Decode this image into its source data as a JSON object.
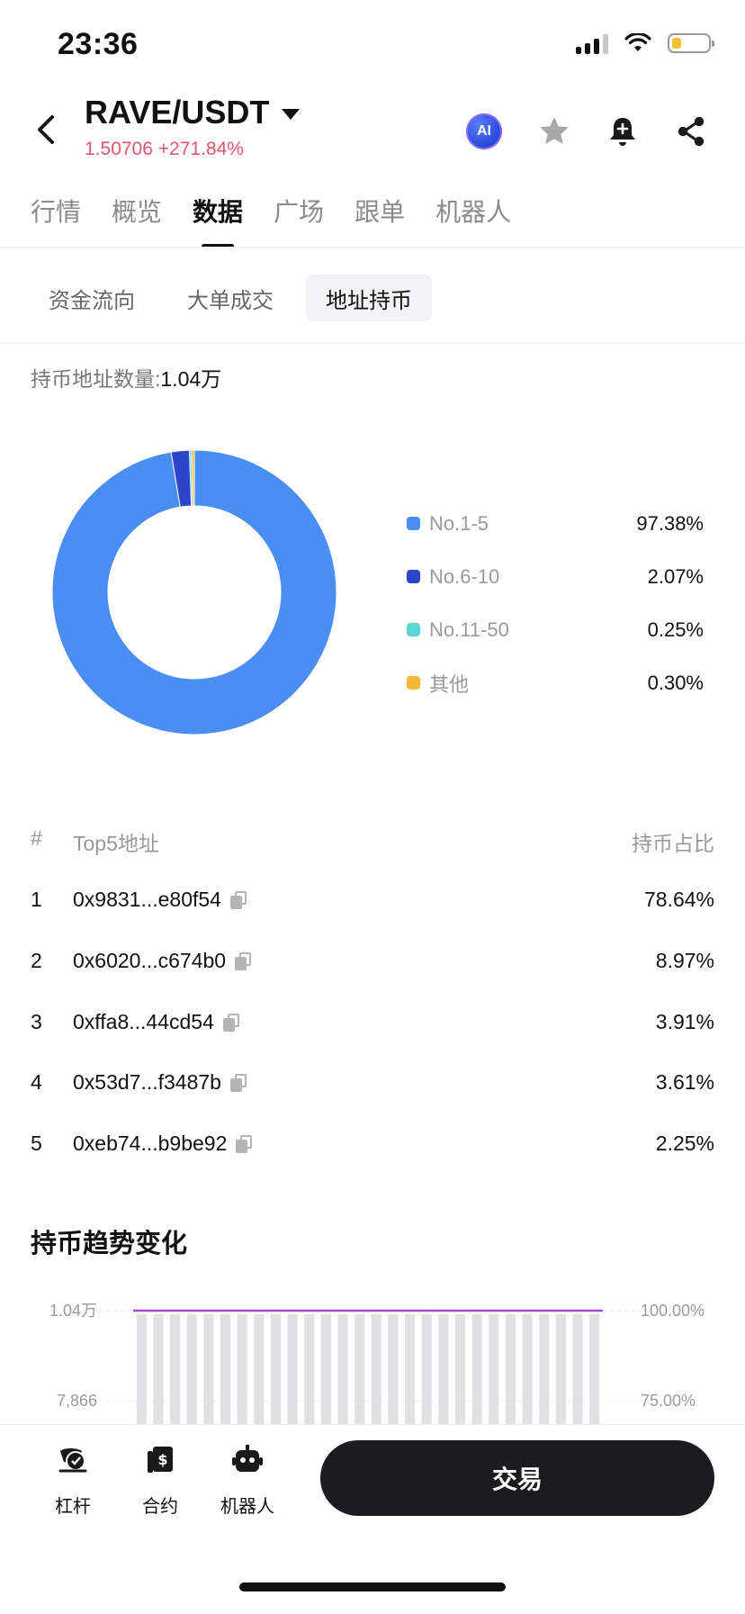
{
  "status": {
    "time": "23:36"
  },
  "header": {
    "pair": "RAVE/USDT",
    "price": "1.50706",
    "change": "+271.84%",
    "ai_label": "AI"
  },
  "tabs": [
    {
      "label": "行情"
    },
    {
      "label": "概览"
    },
    {
      "label": "数据",
      "active": true
    },
    {
      "label": "广场"
    },
    {
      "label": "跟单"
    },
    {
      "label": "机器人"
    }
  ],
  "sub_tabs": [
    {
      "label": "资金流向"
    },
    {
      "label": "大单成交"
    },
    {
      "label": "地址持币",
      "active": true
    }
  ],
  "holders": {
    "label": "持币地址数量:",
    "value": "1.04万"
  },
  "legend": [
    {
      "label": "No.1-5",
      "pct": "97.38%",
      "color": "#4a8ef4"
    },
    {
      "label": "No.6-10",
      "pct": "2.07%",
      "color": "#2d45c8"
    },
    {
      "label": "No.11-50",
      "pct": "0.25%",
      "color": "#5fd6d6"
    },
    {
      "label": "其他",
      "pct": "0.30%",
      "color": "#f0b93a"
    }
  ],
  "chart_data": [
    {
      "type": "pie",
      "categories": [
        "No.1-5",
        "No.6-10",
        "No.11-50",
        "其他"
      ],
      "values": [
        97.38,
        2.07,
        0.25,
        0.3
      ],
      "colors": [
        "#4a8ef4",
        "#2d45c8",
        "#5fd6d6",
        "#f0b93a"
      ],
      "donut": true,
      "legend": "right"
    },
    {
      "type": "bar",
      "title": "持币趋势变化",
      "bar_count": 28,
      "left_ticks": [
        "1.04万",
        "7,866"
      ],
      "right_ticks": [
        "100.00%",
        "75.00%"
      ],
      "line_value_pct": 100,
      "bar_color": "#e1e1e3",
      "line_color": "#a04bd0"
    }
  ],
  "table": {
    "headers": {
      "index": "#",
      "address": "Top5地址",
      "share": "持币占比"
    },
    "rows": [
      {
        "index": "1",
        "address": "0x9831...e80f54",
        "share": "78.64%"
      },
      {
        "index": "2",
        "address": "0x6020...c674b0",
        "share": "8.97%"
      },
      {
        "index": "3",
        "address": "0xffa8...44cd54",
        "share": "3.91%"
      },
      {
        "index": "4",
        "address": "0x53d7...f3487b",
        "share": "3.61%"
      },
      {
        "index": "5",
        "address": "0xeb74...b9be92",
        "share": "2.25%"
      }
    ]
  },
  "trend": {
    "title": "持币趋势变化"
  },
  "bottom_nav": [
    {
      "label": "杠杆",
      "icon": "leverage-icon"
    },
    {
      "label": "合约",
      "icon": "contract-icon"
    },
    {
      "label": "机器人",
      "icon": "robot-icon"
    }
  ],
  "trade_button": {
    "label": "交易"
  }
}
